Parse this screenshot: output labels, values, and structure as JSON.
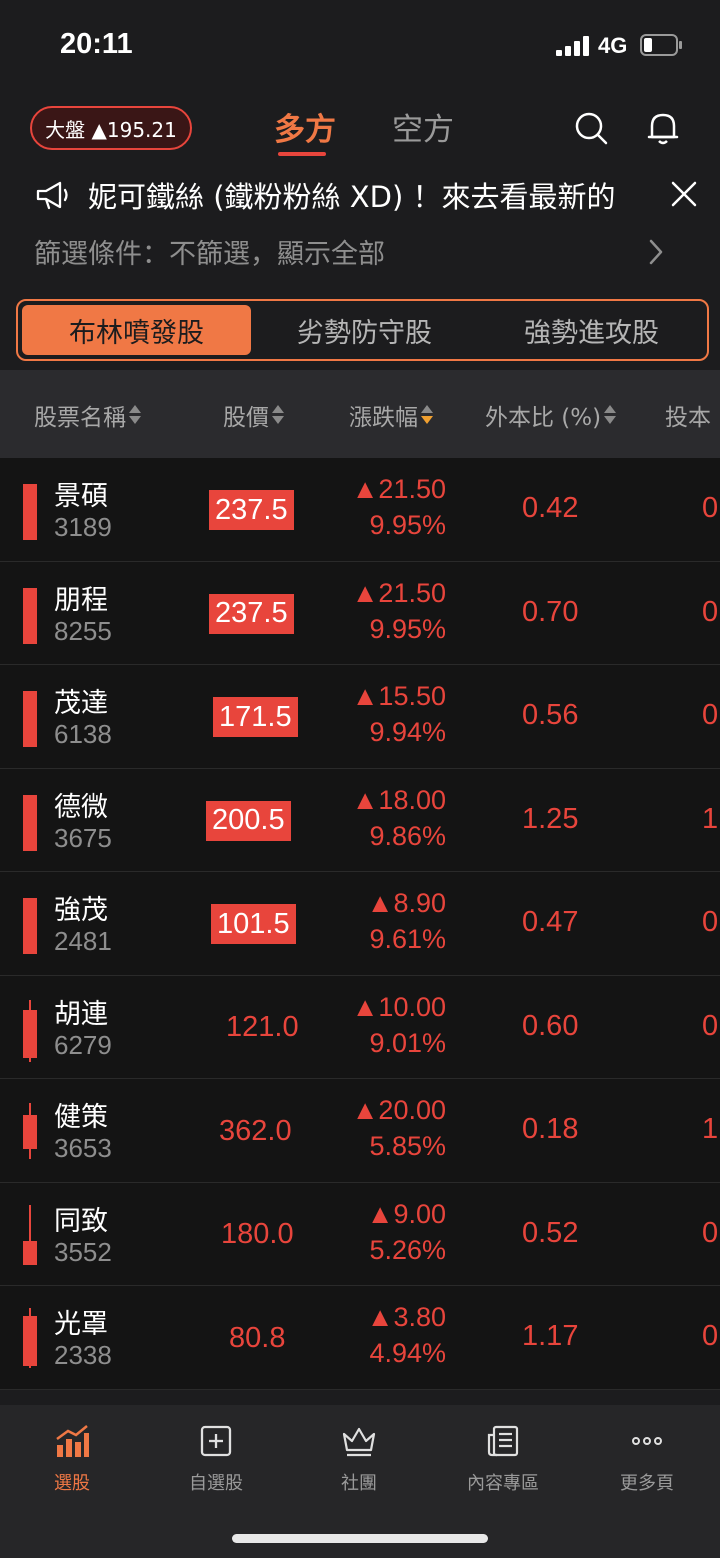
{
  "status": {
    "time": "20:11",
    "network": "4G"
  },
  "header": {
    "index_label": "大盤 ▲195.21",
    "tabs": [
      {
        "label": "多方"
      },
      {
        "label": "空方"
      }
    ]
  },
  "banner": {
    "text": "妮可鐵絲 (鐵粉粉絲 XD) ！來去看最新的"
  },
  "filter": {
    "text": "篩選條件：不篩選，顯示全部"
  },
  "segments": [
    {
      "label": "布林噴發股"
    },
    {
      "label": "劣勢防守股"
    },
    {
      "label": "強勢進攻股"
    }
  ],
  "table": {
    "headers": {
      "name": "股票名稱",
      "price": "股價",
      "change": "漲跌幅",
      "ratio": "外本比 (%)",
      "inv": "投本"
    },
    "rows": [
      {
        "name": "景碩",
        "code": "3189",
        "price": "237.5",
        "boxed": true,
        "change": "▲21.50",
        "pct": "9.95%",
        "ratio": "0.42",
        "inv": "0"
      },
      {
        "name": "朋程",
        "code": "8255",
        "price": "237.5",
        "boxed": true,
        "change": "▲21.50",
        "pct": "9.95%",
        "ratio": "0.70",
        "inv": "0"
      },
      {
        "name": "茂達",
        "code": "6138",
        "price": "171.5",
        "boxed": true,
        "change": "▲15.50",
        "pct": "9.94%",
        "ratio": "0.56",
        "inv": "0"
      },
      {
        "name": "德微",
        "code": "3675",
        "price": "200.5",
        "boxed": true,
        "change": "▲18.00",
        "pct": "9.86%",
        "ratio": "1.25",
        "inv": "1"
      },
      {
        "name": "強茂",
        "code": "2481",
        "price": "101.5",
        "boxed": true,
        "change": "▲8.90",
        "pct": "9.61%",
        "ratio": "0.47",
        "inv": "0"
      },
      {
        "name": "胡連",
        "code": "6279",
        "price": "121.0",
        "boxed": false,
        "change": "▲10.00",
        "pct": "9.01%",
        "ratio": "0.60",
        "inv": "0"
      },
      {
        "name": "健策",
        "code": "3653",
        "price": "362.0",
        "boxed": false,
        "change": "▲20.00",
        "pct": "5.85%",
        "ratio": "0.18",
        "inv": "1"
      },
      {
        "name": "同致",
        "code": "3552",
        "price": "180.0",
        "boxed": false,
        "change": "▲9.00",
        "pct": "5.26%",
        "ratio": "0.52",
        "inv": "0"
      },
      {
        "name": "光罩",
        "code": "2338",
        "price": "80.8",
        "boxed": false,
        "change": "▲3.80",
        "pct": "4.94%",
        "ratio": "1.17",
        "inv": "0"
      }
    ]
  },
  "nav": [
    {
      "label": "選股",
      "icon": "chart-bars-icon"
    },
    {
      "label": "自選股",
      "icon": "add-box-icon"
    },
    {
      "label": "社團",
      "icon": "crown-icon"
    },
    {
      "label": "內容專區",
      "icon": "news-icon"
    },
    {
      "label": "更多頁",
      "icon": "more-dots-icon"
    }
  ],
  "colors": {
    "accent": "#f07845",
    "up": "#e8453c",
    "background": "#1c1c1e"
  }
}
